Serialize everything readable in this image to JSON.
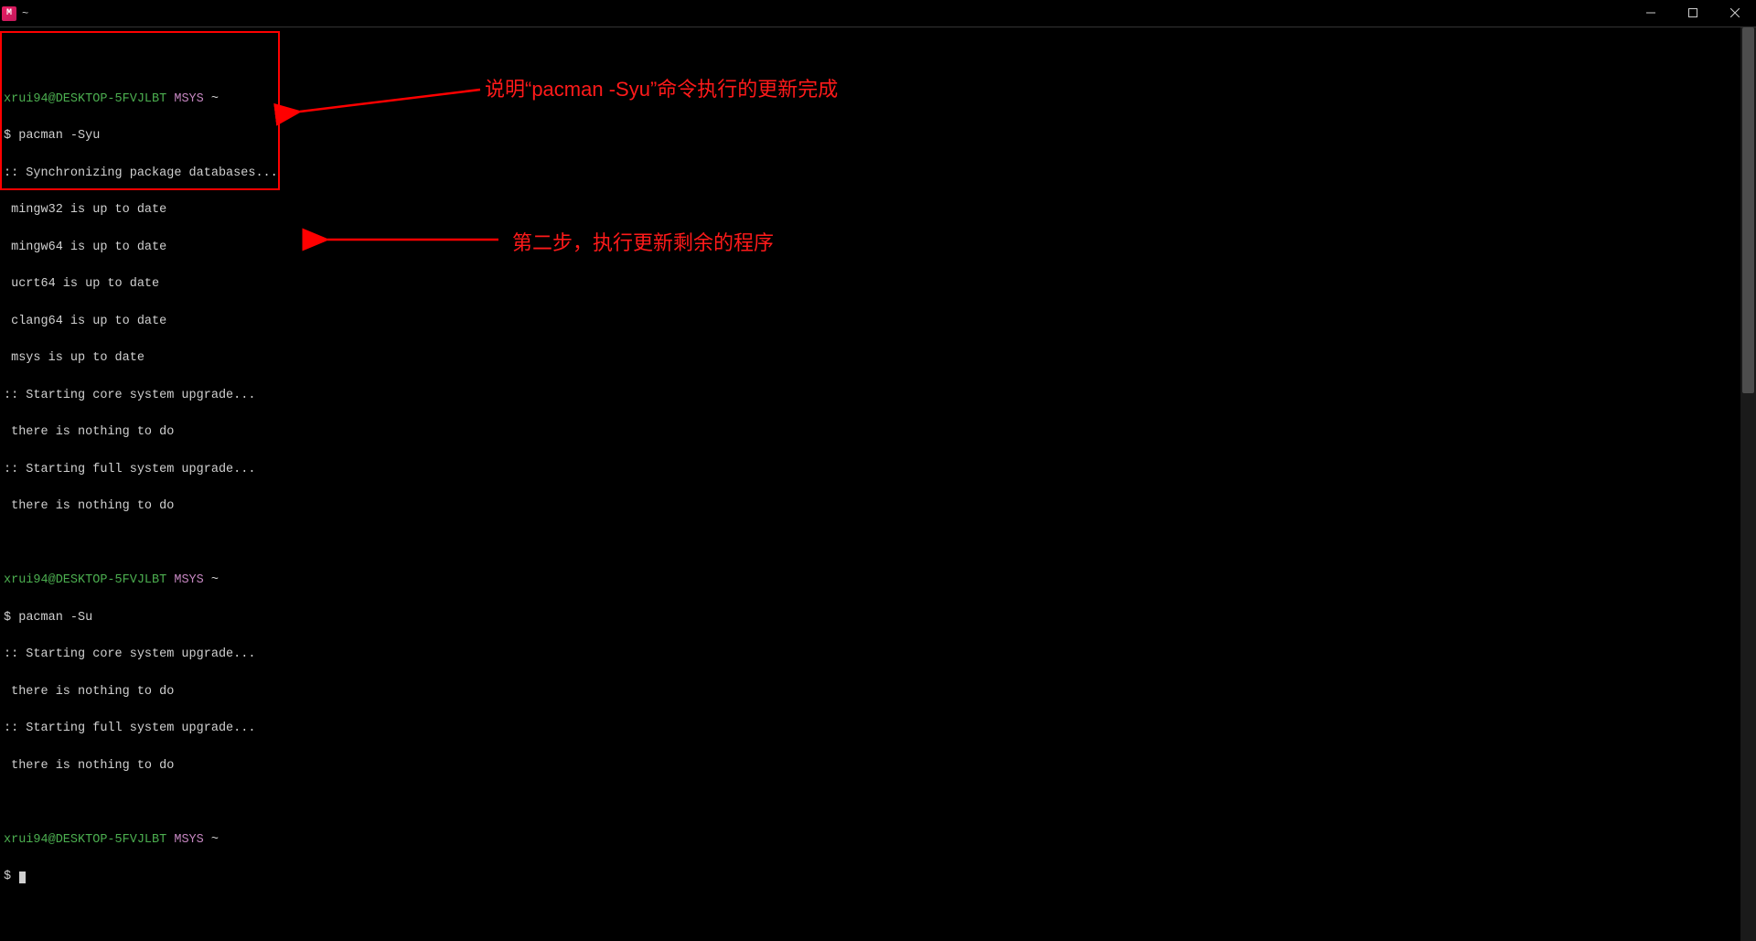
{
  "window": {
    "title": "~",
    "app_icon_letter": "M"
  },
  "prompt": {
    "user": "xrui94@DESKTOP-5FVJLBT",
    "env": "MSYS",
    "path": "~",
    "symbol": "$"
  },
  "block1": {
    "command": "pacman -Syu",
    "lines": [
      ":: Synchronizing package databases...",
      " mingw32 is up to date",
      " mingw64 is up to date",
      " ucrt64 is up to date",
      " clang64 is up to date",
      " msys is up to date",
      ":: Starting core system upgrade...",
      " there is nothing to do",
      ":: Starting full system upgrade...",
      " there is nothing to do"
    ]
  },
  "block2": {
    "command": "pacman -Su",
    "lines": [
      ":: Starting core system upgrade...",
      " there is nothing to do",
      ":: Starting full system upgrade...",
      " there is nothing to do"
    ]
  },
  "annotations": {
    "a1": "说明“pacman -Syu”命令执行的更新完成",
    "a2": "第二步，执行更新剩余的程序"
  },
  "colors": {
    "accent_red": "#ff0000",
    "prompt_user": "#4caf50",
    "prompt_env": "#c586c0"
  }
}
